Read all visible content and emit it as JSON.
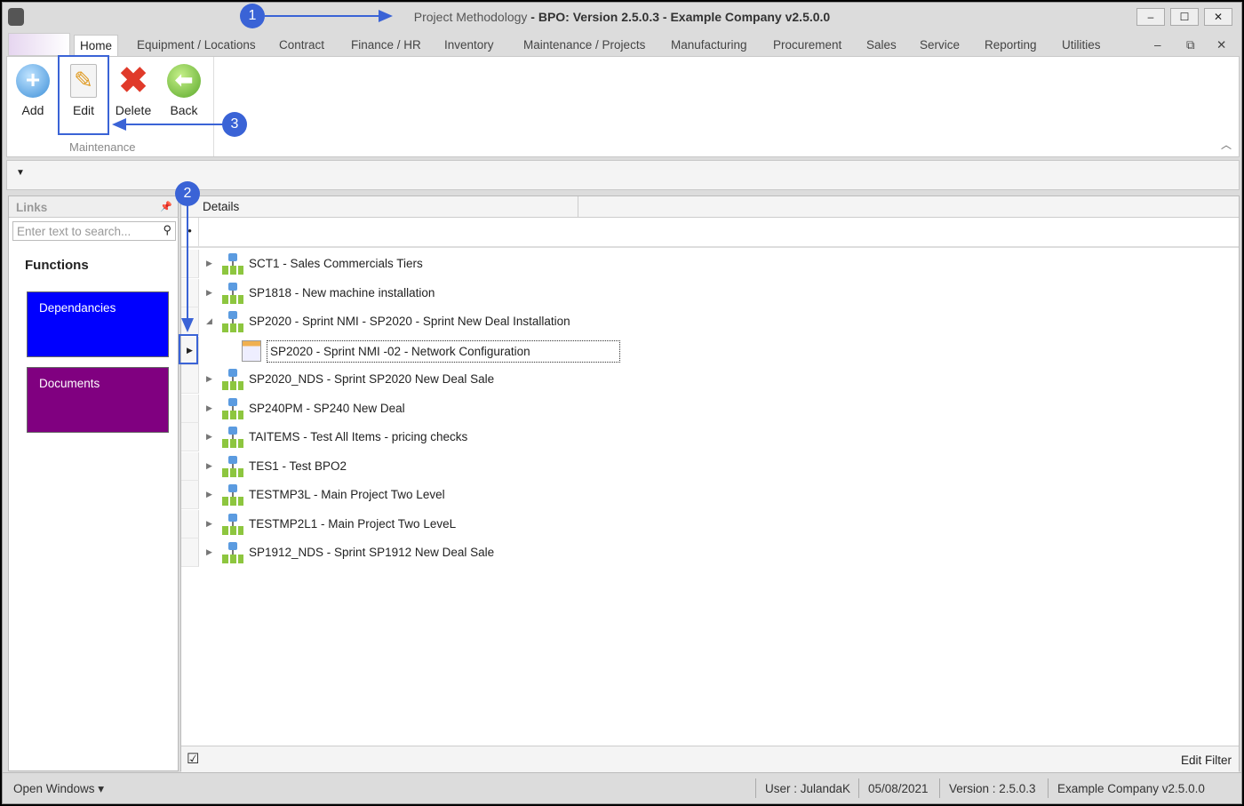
{
  "window": {
    "title_part1": "Project Methodology",
    "title_part2": " - BPO: Version 2.5.0.3 - Example Company v2.5.0.0",
    "controls": [
      "–",
      "☐",
      "✕"
    ]
  },
  "tabs": [
    "Home",
    "Equipment / Locations",
    "Contract",
    "Finance / HR",
    "Inventory",
    "Maintenance / Projects",
    "Manufacturing",
    "Procurement",
    "Sales",
    "Service",
    "Reporting",
    "Utilities"
  ],
  "ribbon": {
    "buttons": [
      "Add",
      "Edit",
      "Delete",
      "Back"
    ],
    "group": "Maintenance"
  },
  "links": {
    "title": "Links",
    "search_placeholder": "Enter text to search...",
    "functions_title": "Functions",
    "functions": [
      {
        "label": "Dependancies",
        "color": "#0000ff"
      },
      {
        "label": "Documents",
        "color": "#800080"
      }
    ]
  },
  "grid": {
    "column": "Details",
    "rows": [
      {
        "label": "SCT1 - Sales Commercials Tiers",
        "type": "project",
        "expanded": false
      },
      {
        "label": "SP1818 - New machine installation",
        "type": "project",
        "expanded": false
      },
      {
        "label": "SP2020 - Sprint NMI - SP2020 - Sprint New Deal Installation",
        "type": "project",
        "expanded": true
      },
      {
        "label": "SP2020 - Sprint NMI -02 - Network Configuration",
        "type": "task",
        "selected": true
      },
      {
        "label": "SP2020_NDS - Sprint SP2020 New Deal Sale",
        "type": "project",
        "expanded": false
      },
      {
        "label": "SP240PM - SP240 New Deal",
        "type": "project",
        "expanded": false
      },
      {
        "label": "TAITEMS - Test All Items - pricing checks",
        "type": "project",
        "expanded": false
      },
      {
        "label": "TES1 - Test BPO2",
        "type": "project",
        "expanded": false
      },
      {
        "label": "TESTMP3L - Main Project Two Level",
        "type": "project",
        "expanded": false
      },
      {
        "label": "TESTMP2L1 - Main Project Two LeveL",
        "type": "project",
        "expanded": false
      },
      {
        "label": "SP1912_NDS - Sprint SP1912 New Deal Sale",
        "type": "project",
        "expanded": false
      }
    ],
    "edit_filter": "Edit Filter"
  },
  "status": {
    "open_windows": "Open Windows ▾",
    "user": "User : JulandaK",
    "date": "05/08/2021",
    "version": "Version : 2.5.0.3",
    "company": "Example Company v2.5.0.0"
  },
  "callouts": [
    "1",
    "2",
    "3"
  ],
  "accent": "#3a63d6"
}
